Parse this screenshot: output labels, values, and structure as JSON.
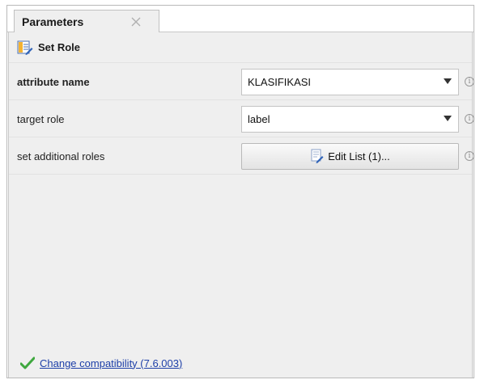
{
  "tabs": [
    {
      "label": "Parameters",
      "close_symbol": "✕"
    }
  ],
  "operator": {
    "title": "Set Role",
    "icon": "set-role-icon"
  },
  "parameters": [
    {
      "label": "attribute name",
      "bold": true,
      "type": "select",
      "value": "KLASIFIKASI"
    },
    {
      "label": "target role",
      "bold": false,
      "type": "select",
      "value": "label"
    },
    {
      "label": "set additional roles",
      "bold": false,
      "type": "button",
      "value": "Edit List (1)..."
    }
  ],
  "info_symbol": "i",
  "compatibility": {
    "label": "Change compatibility (7.6.003)",
    "icon": "check-icon"
  },
  "colors": {
    "accent_check": "#3fa83f",
    "link": "#1d3fa8",
    "panel_bg": "#efefef"
  }
}
